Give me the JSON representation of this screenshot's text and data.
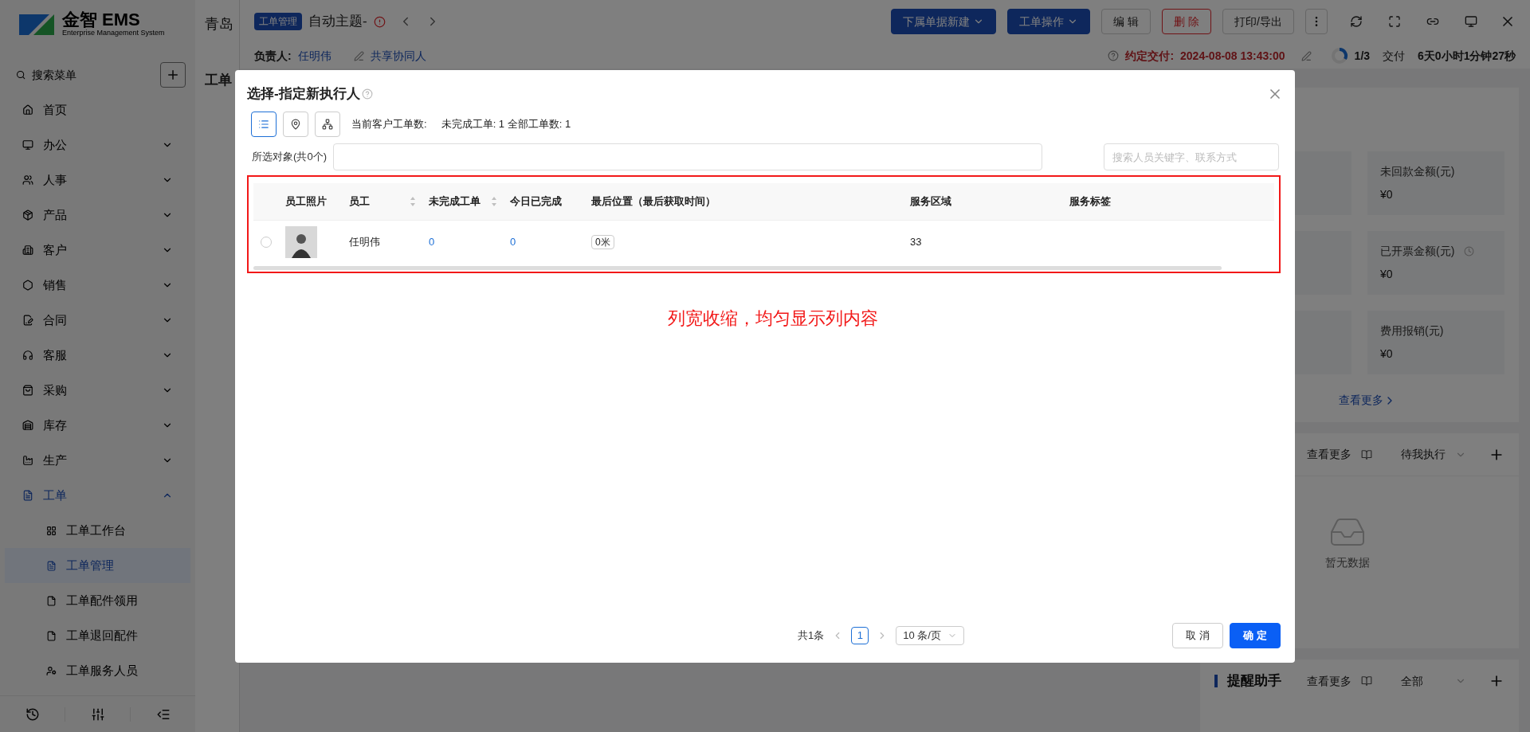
{
  "sidebar": {
    "logo": {
      "name": "金智 EMS",
      "tagline": "Enterprise Management System"
    },
    "search": {
      "placeholder": "搜索菜单"
    },
    "items": [
      {
        "label": "首页",
        "kind": "link",
        "selected": false
      },
      {
        "label": "办公",
        "kind": "group",
        "expanded": false,
        "selected": false
      },
      {
        "label": "人事",
        "kind": "group",
        "expanded": false,
        "selected": false
      },
      {
        "label": "产品",
        "kind": "group",
        "expanded": false,
        "selected": false
      },
      {
        "label": "客户",
        "kind": "group",
        "expanded": false,
        "selected": false
      },
      {
        "label": "销售",
        "kind": "group",
        "expanded": false,
        "selected": false
      },
      {
        "label": "合同",
        "kind": "group",
        "expanded": false,
        "selected": false
      },
      {
        "label": "客服",
        "kind": "group",
        "expanded": false,
        "selected": false
      },
      {
        "label": "采购",
        "kind": "group",
        "expanded": false,
        "selected": false
      },
      {
        "label": "库存",
        "kind": "group",
        "expanded": false,
        "selected": false
      },
      {
        "label": "生产",
        "kind": "group",
        "expanded": false,
        "selected": false
      },
      {
        "label": "工单",
        "kind": "group",
        "expanded": true,
        "selected": true,
        "children": [
          {
            "label": "工单工作台",
            "selected": false
          },
          {
            "label": "工单管理",
            "selected": true
          },
          {
            "label": "工单配件领用",
            "selected": false
          },
          {
            "label": "工单退回配件",
            "selected": false
          },
          {
            "label": "工单服务人员",
            "selected": false
          }
        ]
      }
    ]
  },
  "page": {
    "company": "青岛",
    "title": "工单"
  },
  "header": {
    "tag": "工单管理",
    "subject": "自动主题-",
    "actions": [
      {
        "label": "下属单据新建",
        "kind": "primary"
      },
      {
        "label": "工单操作",
        "kind": "primary"
      },
      {
        "label": "编 辑",
        "kind": "default"
      },
      {
        "label": "删 除",
        "kind": "danger"
      },
      {
        "label": "打印/导出",
        "kind": "default"
      }
    ],
    "owner_label": "负责人:",
    "owner": "任明伟",
    "share": "共享协同人",
    "due_label": "约定交付:",
    "due": "2024-08-08 13:43:00",
    "progress": {
      "text": "1/3"
    },
    "stage": "交付",
    "elapsed": "6天0小时1分钟27秒"
  },
  "stats": [
    {
      "label": "未回款金额(元)",
      "value": "¥0",
      "clock": false
    },
    {
      "label": "已开票金额(元)",
      "value": "¥0",
      "clock": true
    },
    {
      "label": "费用报销(元)",
      "value": "¥0",
      "clock": false
    }
  ],
  "stats_more": "查看更多",
  "tasks": {
    "more": "查看更多",
    "filter": "待我执行",
    "empty": "暂无数据"
  },
  "reminders": {
    "title": "提醒助手",
    "more": "查看更多",
    "filter": "全部"
  },
  "dialog": {
    "title": "选择-指定新执行人",
    "views": [
      {
        "selected": true
      },
      {
        "selected": false
      },
      {
        "selected": false
      }
    ],
    "summary_label": "当前客户工单数:",
    "summary": "未完成工单: 1 全部工单数: 1",
    "selected_label": "所选对象(共0个)",
    "search": {
      "placeholder": "搜索人员关键字、联系方式"
    },
    "table": {
      "columns": [
        {
          "label": "员工照片",
          "sortable": false
        },
        {
          "label": "员工",
          "sortable": true
        },
        {
          "label": "未完成工单",
          "sortable": true
        },
        {
          "label": "今日已完成",
          "sortable": false
        },
        {
          "label": "最后位置（最后获取时间）",
          "sortable": false
        },
        {
          "label": "服务区域",
          "sortable": false
        },
        {
          "label": "服务标签",
          "sortable": false
        }
      ],
      "rows": [
        {
          "selected": false,
          "name": "任明伟",
          "open": "0",
          "done_today": "0",
          "location": "0米",
          "area": "33"
        }
      ]
    },
    "annotation": "列宽收缩，均匀显示列内容",
    "pagination": {
      "total": "共1条",
      "pages": [
        {
          "label": "1",
          "selected": true
        }
      ],
      "page_size": "10 条/页"
    },
    "buttons": [
      {
        "label": "取 消",
        "kind": "default"
      },
      {
        "label": "确 定",
        "kind": "primary"
      }
    ]
  }
}
